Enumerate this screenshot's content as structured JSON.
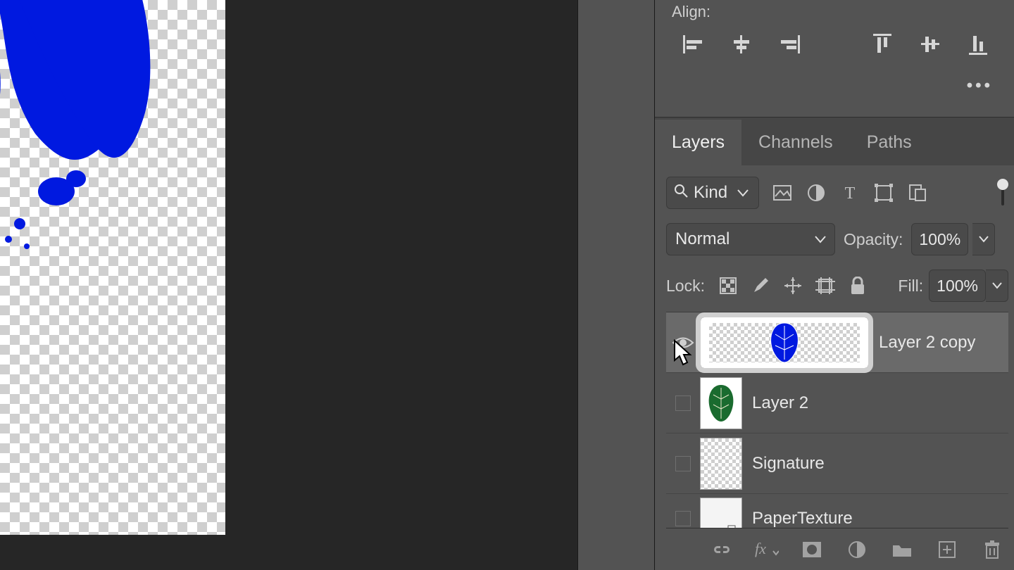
{
  "align": {
    "label": "Align:"
  },
  "tabs": {
    "layers": "Layers",
    "channels": "Channels",
    "paths": "Paths"
  },
  "filter": {
    "kind": "Kind"
  },
  "blend": {
    "mode": "Normal",
    "opacity_label": "Opacity:",
    "opacity_value": "100%"
  },
  "lock": {
    "label": "Lock:",
    "fill_label": "Fill:",
    "fill_value": "100%"
  },
  "layers": {
    "items": [
      {
        "name": "Layer 2 copy"
      },
      {
        "name": "Layer 2"
      },
      {
        "name": "Signature"
      },
      {
        "name": "PaperTexture"
      }
    ]
  },
  "more": "•••",
  "colors": {
    "shape": "#0019e0"
  }
}
